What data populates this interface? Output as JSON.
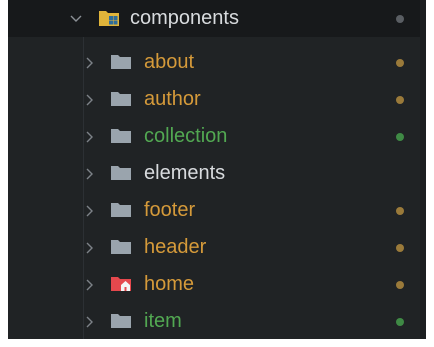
{
  "explorer": {
    "root": {
      "label": "components",
      "label_color": "#d8dbde",
      "dot_color": "#5a5e63",
      "expanded": true,
      "icon": "folder-components-icon"
    },
    "items": [
      {
        "label": "about",
        "label_color": "#d59a3a",
        "dot_color": "#9a7a3a",
        "icon": "folder-icon"
      },
      {
        "label": "author",
        "label_color": "#d59a3a",
        "dot_color": "#9a7a3a",
        "icon": "folder-icon"
      },
      {
        "label": "collection",
        "label_color": "#52a852",
        "dot_color": "#3f8a45",
        "icon": "folder-icon"
      },
      {
        "label": "elements",
        "label_color": "#d8dbde",
        "dot_color": "",
        "icon": "folder-icon"
      },
      {
        "label": "footer",
        "label_color": "#d59a3a",
        "dot_color": "#9a7a3a",
        "icon": "folder-icon"
      },
      {
        "label": "header",
        "label_color": "#d59a3a",
        "dot_color": "#9a7a3a",
        "icon": "folder-icon"
      },
      {
        "label": "home",
        "label_color": "#d59a3a",
        "dot_color": "#9a7a3a",
        "icon": "folder-home-icon"
      },
      {
        "label": "item",
        "label_color": "#52a852",
        "dot_color": "#3f8a45",
        "icon": "folder-icon"
      }
    ]
  }
}
